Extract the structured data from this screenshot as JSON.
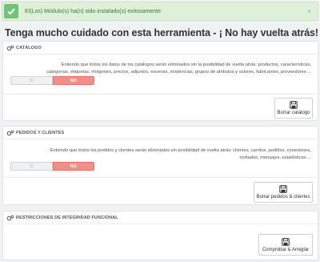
{
  "alert": {
    "message": "El(Los) Módulo(s) ha(n) sido instalado(s) exitosamente",
    "close": "×"
  },
  "page_title": "Tenga mucho cuidado con esta herramienta - ¡ No hay vuelta atrás!",
  "catalog": {
    "title": "CATÁLOGO",
    "desc_line1": "Entiendo que todos los datos de los catálogos serán eliminados sin la posibilidad de vuelta atrás: productos, características,",
    "desc_line2": "categorías, etiquetas, imágenes, precios, adjuntos, escenas, existencias, grupos de atributos y valores, fabricantes, proveedores ...",
    "toggle_yes": "SÍ",
    "toggle_no": "NO",
    "button": "Borrar catálogo"
  },
  "orders": {
    "title": "PEDIDOS Y CLIENTES",
    "desc_line1": "Entiendo que todos los pedidos y clientes serán eliminados sin posibilidad de vuelta atrás: clientes, carritos, pedidos, conexiones,",
    "desc_line2": "invitados, mensajes, estadísticas ...",
    "toggle_yes": "SÍ",
    "toggle_no": "NO",
    "button": "Borrar pedidos & clientes"
  },
  "integrity": {
    "title": "RESTRICCIONES DE INTEGRIDAD FUNCIONAL",
    "button": "Comprobar & Arreglar"
  },
  "colors": {
    "success": "#72c279",
    "danger": "#ef8f86"
  },
  "icons": {
    "alert": "check-icon",
    "panel": "cogs-icon",
    "button": "save-icon"
  }
}
